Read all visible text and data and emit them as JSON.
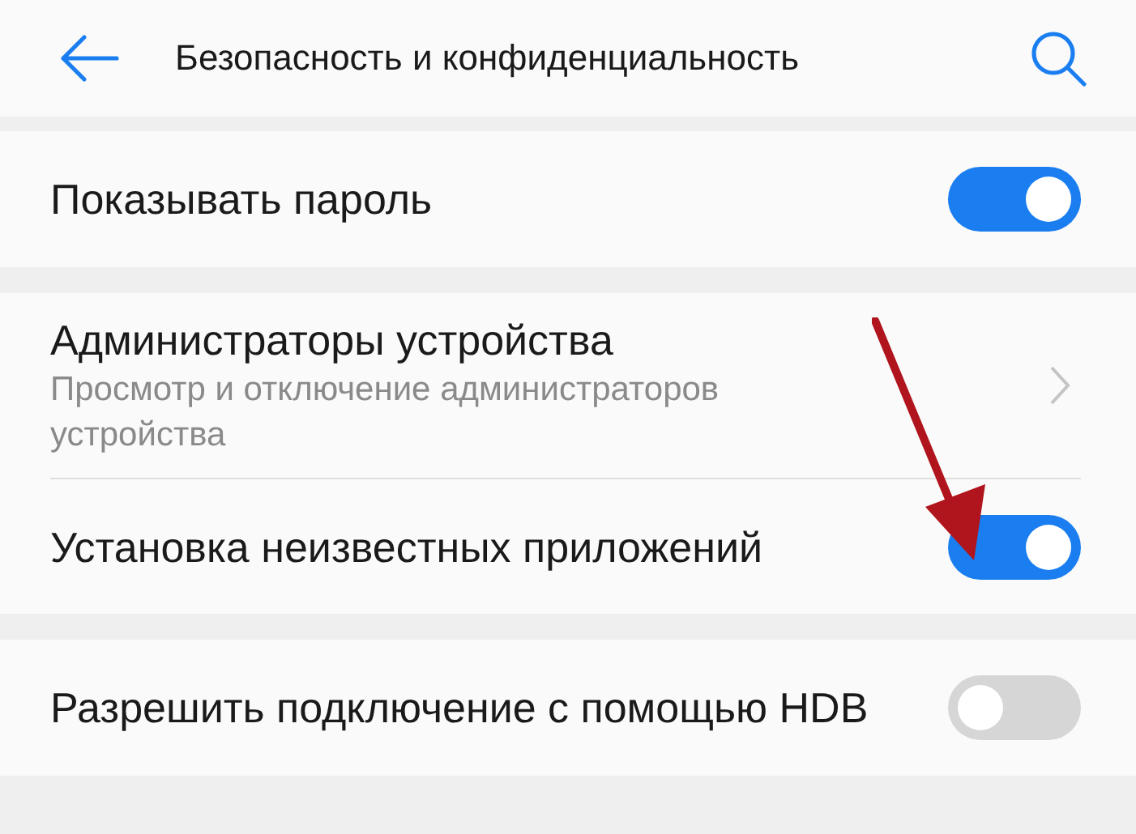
{
  "header": {
    "title": "Безопасность и конфиденциальность"
  },
  "groups": [
    {
      "items": [
        {
          "kind": "toggle",
          "title": "Показывать пароль",
          "on": true
        }
      ]
    },
    {
      "items": [
        {
          "kind": "link",
          "title": "Администраторы устройства",
          "subtitle": "Просмотр и отключение администраторов устройства"
        },
        {
          "kind": "toggle",
          "title": "Установка неизвестных приложений",
          "on": true
        }
      ]
    },
    {
      "items": [
        {
          "kind": "toggle",
          "title": "Разрешить подключение с помощью HDB",
          "on": false
        }
      ]
    }
  ]
}
